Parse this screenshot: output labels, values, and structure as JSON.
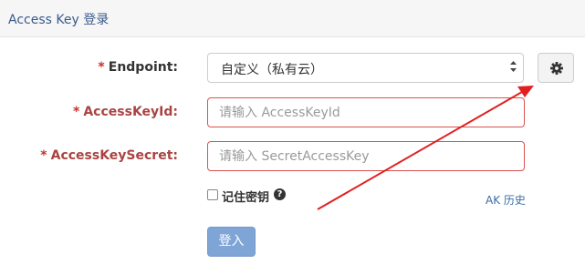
{
  "header": {
    "title": "Access Key 登录"
  },
  "form": {
    "required_mark": "*",
    "endpoint": {
      "label": "Endpoint:",
      "selected": "自定义（私有云）"
    },
    "access_key_id": {
      "label": "AccessKeyId:",
      "placeholder": "请输入 AccessKeyId",
      "value": ""
    },
    "access_key_secret": {
      "label": "AccessKeySecret:",
      "placeholder": "请输入 SecretAccessKey",
      "value": ""
    },
    "remember": {
      "label": "记住密钥",
      "help": "?"
    },
    "ak_history": "AK 历史",
    "submit": "登入"
  },
  "icons": {
    "settings": "gear-icon",
    "help": "question-circle-icon",
    "select_arrow": "chevron-down-icon",
    "annotation": "red-arrow"
  },
  "colors": {
    "label_error": "#a94442",
    "input_border_error": "#d9534f",
    "button_primary": "#7fa5d6",
    "link": "#3a6ea5",
    "annotation_arrow": "#e02020"
  }
}
